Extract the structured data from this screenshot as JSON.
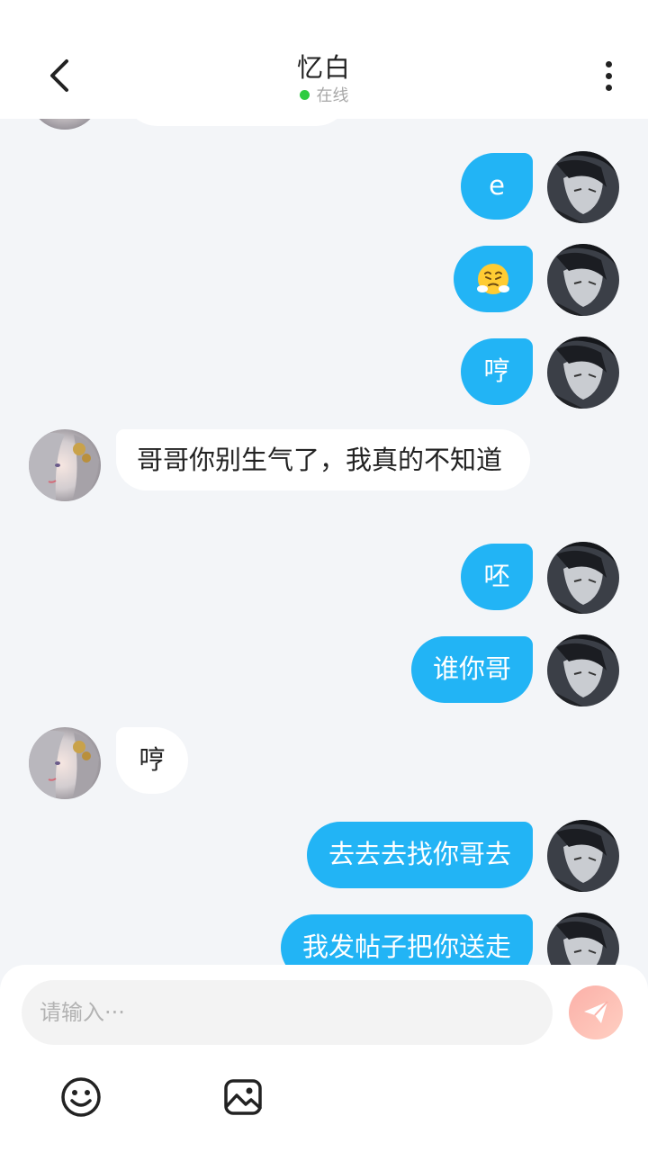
{
  "header": {
    "title": "忆白",
    "status": "在线",
    "status_color": "#2ecc40"
  },
  "messages": [
    {
      "side": "me",
      "text": "e"
    },
    {
      "side": "me",
      "type": "emoji",
      "emoji": "face-with-steam-from-nose"
    },
    {
      "side": "me",
      "text": "哼"
    },
    {
      "side": "her",
      "text": "哥哥你别生气了，我真的不知道"
    },
    {
      "side": "me",
      "text": "呸"
    },
    {
      "side": "me",
      "text": "谁你哥"
    },
    {
      "side": "her",
      "text": "哼"
    },
    {
      "side": "me",
      "text": "去去去找你哥去"
    },
    {
      "side": "me",
      "text": "我发帖子把你送走"
    }
  ],
  "input": {
    "placeholder": "请输入···",
    "value": ""
  },
  "colors": {
    "my_bubble": "#22b4f5",
    "her_bubble": "#ffffff",
    "send_button": "#fbb0a8"
  },
  "toolbar": {
    "icons": [
      "emoji-icon",
      "image-icon"
    ]
  }
}
